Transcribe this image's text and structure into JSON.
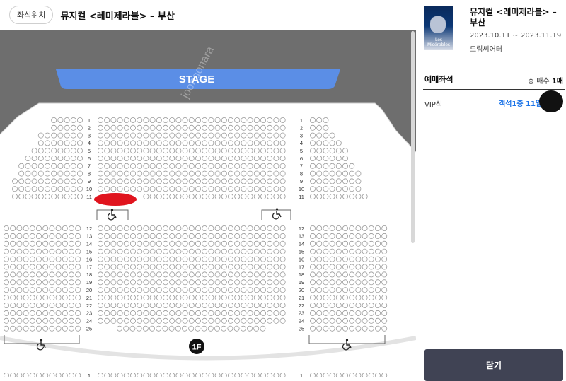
{
  "header": {
    "seat_position_button": "좌석위치",
    "title": "뮤지컬 <레미제라블> – 부산"
  },
  "stage": {
    "label": "STAGE",
    "floor_badge": "1F",
    "watermark": "joongonara"
  },
  "rows": {
    "upper": [
      "1",
      "2",
      "3",
      "4",
      "5",
      "6",
      "7",
      "8",
      "9",
      "10",
      "11"
    ],
    "lower": [
      "12",
      "13",
      "14",
      "15",
      "16",
      "17",
      "18",
      "19",
      "20",
      "21",
      "22",
      "23",
      "24",
      "25"
    ],
    "next_floor_partial": "1"
  },
  "show_info": {
    "poster_text": "Les Misérables",
    "title": "뮤지컬 <레미제라블> – 부산",
    "dates": "2023.10.11 ~ 2023.11.19",
    "venue": "드림씨어터"
  },
  "reservation": {
    "heading": "예매좌석",
    "total_label": "총 매수",
    "total_count": "1매",
    "grade": "VIP석",
    "seat": "객석1층 11열"
  },
  "close_button": "닫기",
  "colors": {
    "stage": "#5b8ee6",
    "seat_stroke": "#9a9a9a",
    "redaction_red": "#e0141e",
    "redaction_black": "#111111",
    "close_button_bg": "#404354",
    "accent_blue": "#1a73e8"
  },
  "icons": [
    "wheelchair-icon"
  ]
}
